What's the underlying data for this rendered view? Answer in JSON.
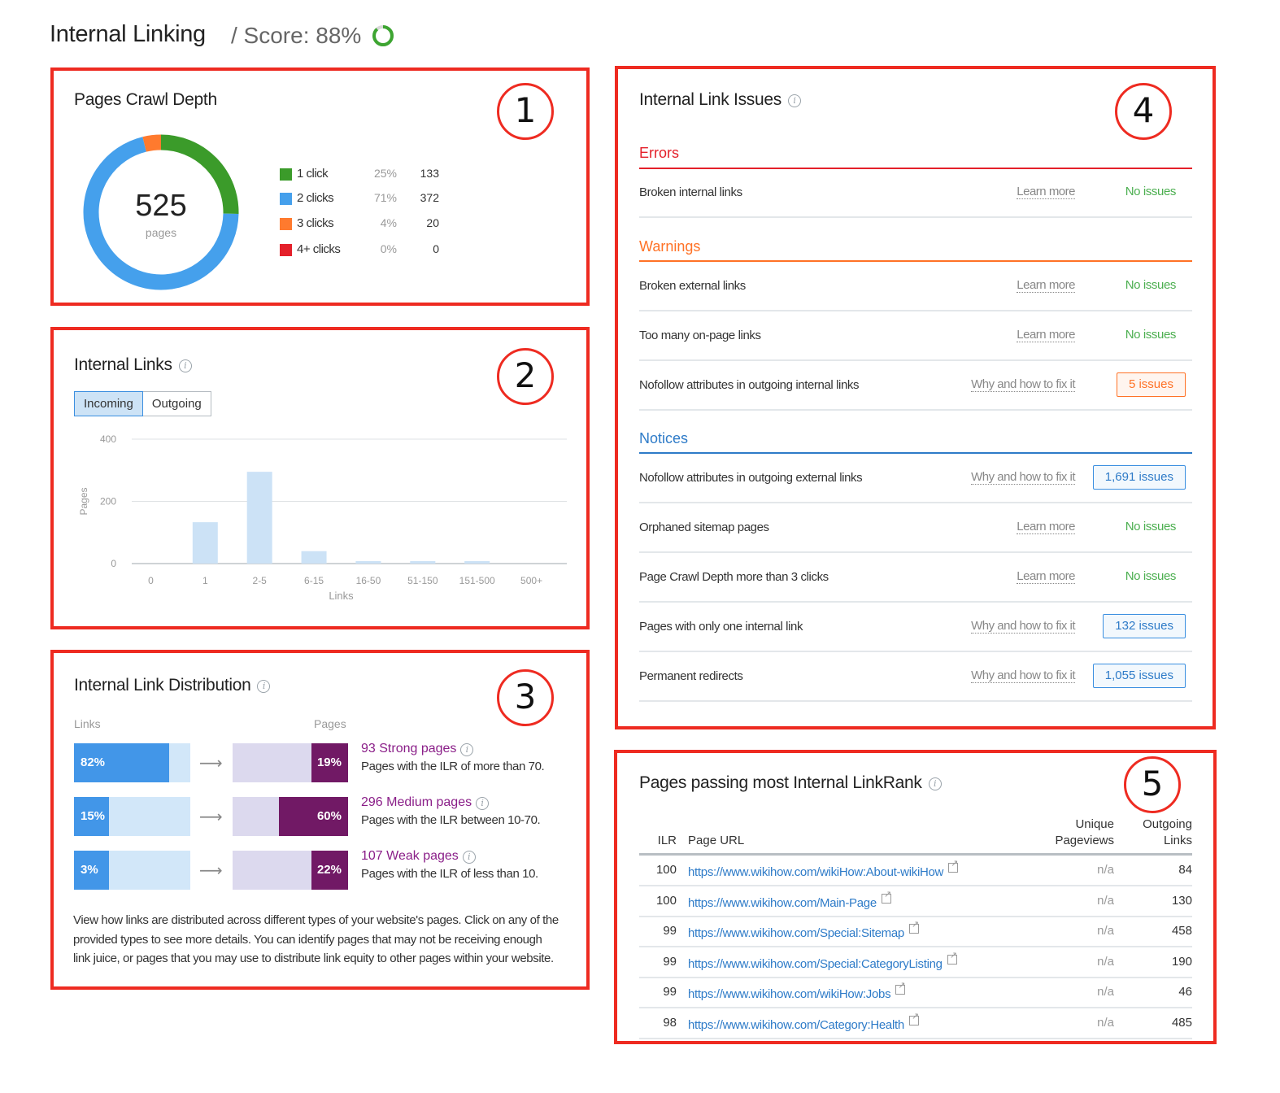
{
  "header": {
    "title": "Internal Linking",
    "score_label": "/ Score: 88%",
    "score_value": 88,
    "score_color": "#3da531"
  },
  "annotations": [
    "1",
    "2",
    "3",
    "4",
    "5"
  ],
  "crawl_depth": {
    "title": "Pages Crawl Depth",
    "total": "525",
    "total_label": "pages",
    "legend": [
      {
        "label": "1 click",
        "pct": "25%",
        "count": "133",
        "value": 133,
        "color": "#3b9b2a"
      },
      {
        "label": "2 clicks",
        "pct": "71%",
        "count": "372",
        "value": 372,
        "color": "#45a0ec"
      },
      {
        "label": "3 clicks",
        "pct": "4%",
        "count": "20",
        "value": 20,
        "color": "#ff7a2e"
      },
      {
        "label": "4+ clicks",
        "pct": "0%",
        "count": "0",
        "value": 0,
        "color": "#e4202a"
      }
    ]
  },
  "internal_links": {
    "title": "Internal Links",
    "tabs": [
      {
        "label": "Incoming",
        "active": true
      },
      {
        "label": "Outgoing",
        "active": false
      }
    ]
  },
  "chart_data": {
    "type": "bar",
    "title": "Internal Links",
    "xlabel": "Links",
    "ylabel": "Pages",
    "categories": [
      "0",
      "1",
      "2-5",
      "6-15",
      "16-50",
      "51-150",
      "151-500",
      "500+"
    ],
    "values": [
      0,
      133,
      295,
      40,
      8,
      8,
      8,
      0
    ],
    "ylim": [
      0,
      400
    ],
    "yticks": [
      0,
      200,
      400
    ],
    "grid": true,
    "bar_color": "#cce2f6"
  },
  "distribution": {
    "title": "Internal Link Distribution",
    "links_label": "Links",
    "pages_label": "Pages",
    "rows": [
      {
        "links_pct": "82%",
        "links_value": 82,
        "pages_pct": "19%",
        "pages_value": 19,
        "title": "93 Strong pages",
        "desc": "Pages with the ILR of more than 70."
      },
      {
        "links_pct": "15%",
        "links_value": 15,
        "pages_pct": "60%",
        "pages_value": 60,
        "title": "296 Medium pages",
        "desc": "Pages with the ILR between 10-70."
      },
      {
        "links_pct": "3%",
        "links_value": 3,
        "pages_pct": "22%",
        "pages_value": 22,
        "title": "107 Weak pages",
        "desc": "Pages with the ILR of less than 10."
      }
    ],
    "paragraph": "View how links are distributed across different types of your website's pages. Click on any of the provided types to see more details. You can identify pages that may not be receiving enough link juice, or pages that you may use to distribute link equity to other pages within your website."
  },
  "issues": {
    "title": "Internal Link Issues",
    "groups": [
      {
        "name": "Errors",
        "color": "#e4202a",
        "items": [
          {
            "name": "Broken internal links",
            "help": "Learn more",
            "status": "No issues",
            "type": "ok"
          }
        ]
      },
      {
        "name": "Warnings",
        "color": "#ff7226",
        "items": [
          {
            "name": "Broken external links",
            "help": "Learn more",
            "status": "No issues",
            "type": "ok"
          },
          {
            "name": "Too many on-page links",
            "help": "Learn more",
            "status": "No issues",
            "type": "ok"
          },
          {
            "name": "Nofollow attributes in outgoing internal links",
            "help": "Why and how to fix it",
            "status": "5 issues",
            "type": "warn"
          }
        ]
      },
      {
        "name": "Notices",
        "color": "#2e7bc8",
        "items": [
          {
            "name": "Nofollow attributes in outgoing external links",
            "help": "Why and how to fix it",
            "status": "1,691 issues",
            "type": "notice"
          },
          {
            "name": "Orphaned sitemap pages",
            "help": "Learn more",
            "status": "No issues",
            "type": "ok"
          },
          {
            "name": "Page Crawl Depth more than 3 clicks",
            "help": "Learn more",
            "status": "No issues",
            "type": "ok"
          },
          {
            "name": "Pages with only one internal link",
            "help": "Why and how to fix it",
            "status": "132 issues",
            "type": "notice"
          },
          {
            "name": "Permanent redirects",
            "help": "Why and how to fix it",
            "status": "1,055 issues",
            "type": "notice"
          }
        ]
      }
    ]
  },
  "linkrank": {
    "title": "Pages passing most Internal LinkRank",
    "columns": {
      "ilr": "ILR",
      "url": "Page URL",
      "pageviews_1": "Unique",
      "pageviews_2": "Pageviews",
      "outgoing_1": "Outgoing",
      "outgoing_2": "Links"
    },
    "rows": [
      {
        "ilr": "100",
        "url": "https://www.wikihow.com/wikiHow:About-wikiHow",
        "pageviews": "n/a",
        "outgoing": "84"
      },
      {
        "ilr": "100",
        "url": "https://www.wikihow.com/Main-Page",
        "pageviews": "n/a",
        "outgoing": "130"
      },
      {
        "ilr": "99",
        "url": "https://www.wikihow.com/Special:Sitemap",
        "pageviews": "n/a",
        "outgoing": "458"
      },
      {
        "ilr": "99",
        "url": "https://www.wikihow.com/Special:CategoryListing",
        "pageviews": "n/a",
        "outgoing": "190"
      },
      {
        "ilr": "99",
        "url": "https://www.wikihow.com/wikiHow:Jobs",
        "pageviews": "n/a",
        "outgoing": "46"
      },
      {
        "ilr": "98",
        "url": "https://www.wikihow.com/Category:Health",
        "pageviews": "n/a",
        "outgoing": "485"
      }
    ]
  }
}
